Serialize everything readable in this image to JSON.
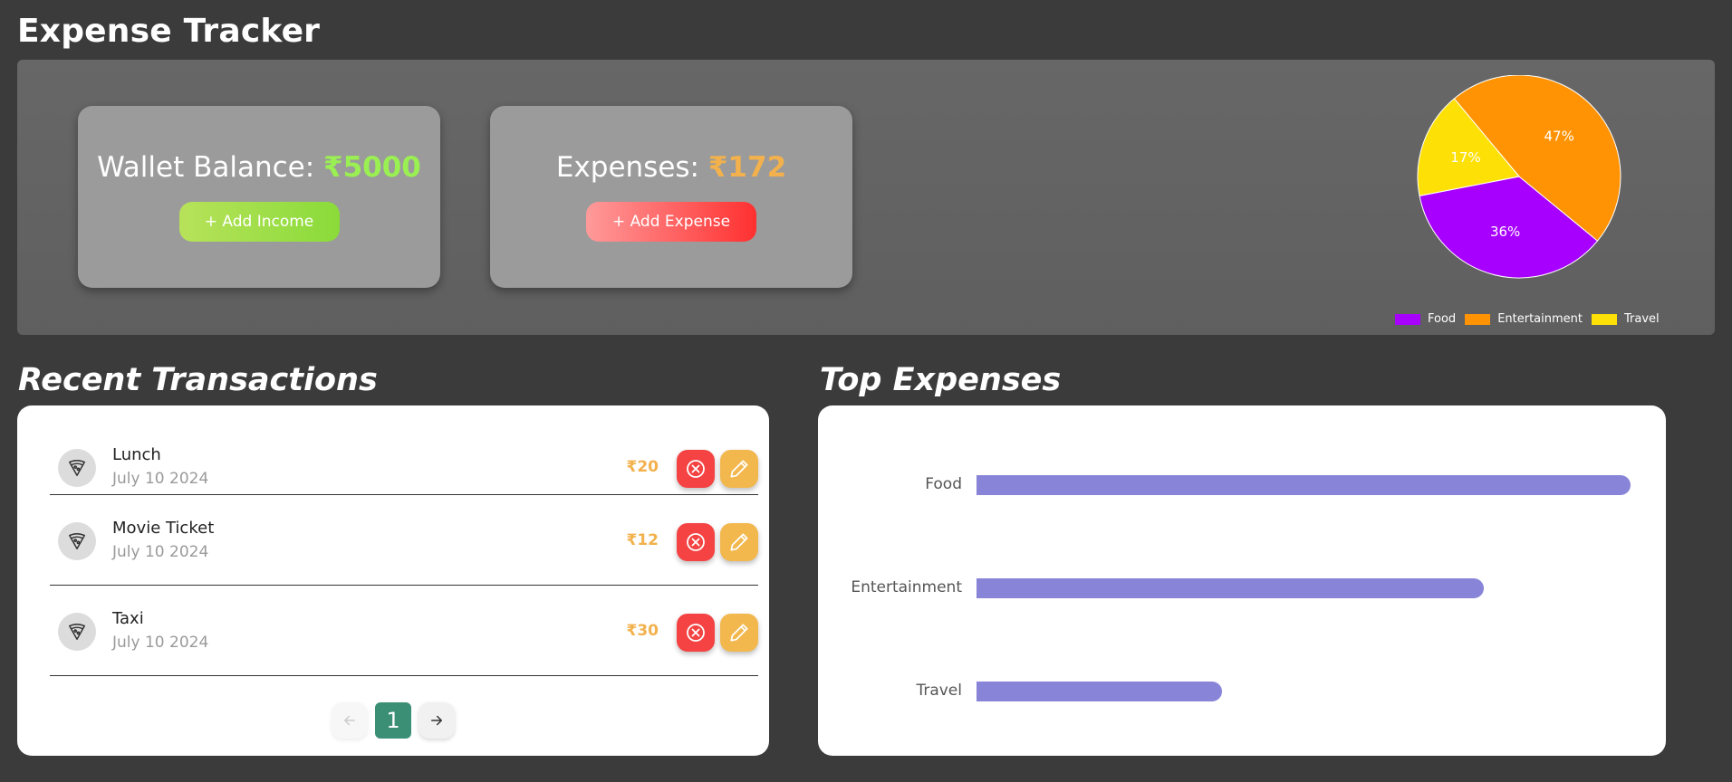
{
  "app": {
    "title": "Expense Tracker"
  },
  "wallet": {
    "label": "Wallet Balance: ",
    "amount": "₹5000",
    "button": "+ Add Income"
  },
  "expenses": {
    "label": "Expenses: ",
    "amount": "₹172",
    "button": "+ Add Expense"
  },
  "colors": {
    "food": "#a800ff",
    "entertainment": "#ff9304",
    "travel": "#fde006",
    "bar": "#8884d8"
  },
  "chart_data": [
    {
      "type": "pie",
      "categories": [
        "Food",
        "Entertainment",
        "Travel"
      ],
      "values": [
        36,
        47,
        17
      ],
      "labels": [
        "36%",
        "47%",
        "17%"
      ],
      "legend": "bottom"
    },
    {
      "type": "bar",
      "orientation": "horizontal",
      "categories": [
        "Food",
        "Entertainment",
        "Travel"
      ],
      "values": [
        100,
        77.5,
        37.5
      ]
    }
  ],
  "recent": {
    "title": "Recent Transactions",
    "transactions": [
      {
        "name": "Lunch",
        "date": "July 10 2024",
        "amount": "₹20"
      },
      {
        "name": "Movie Ticket",
        "date": "July 10 2024",
        "amount": "₹12"
      },
      {
        "name": "Taxi",
        "date": "July 10 2024",
        "amount": "₹30"
      }
    ],
    "page": "1"
  },
  "top": {
    "title": "Top Expenses"
  }
}
